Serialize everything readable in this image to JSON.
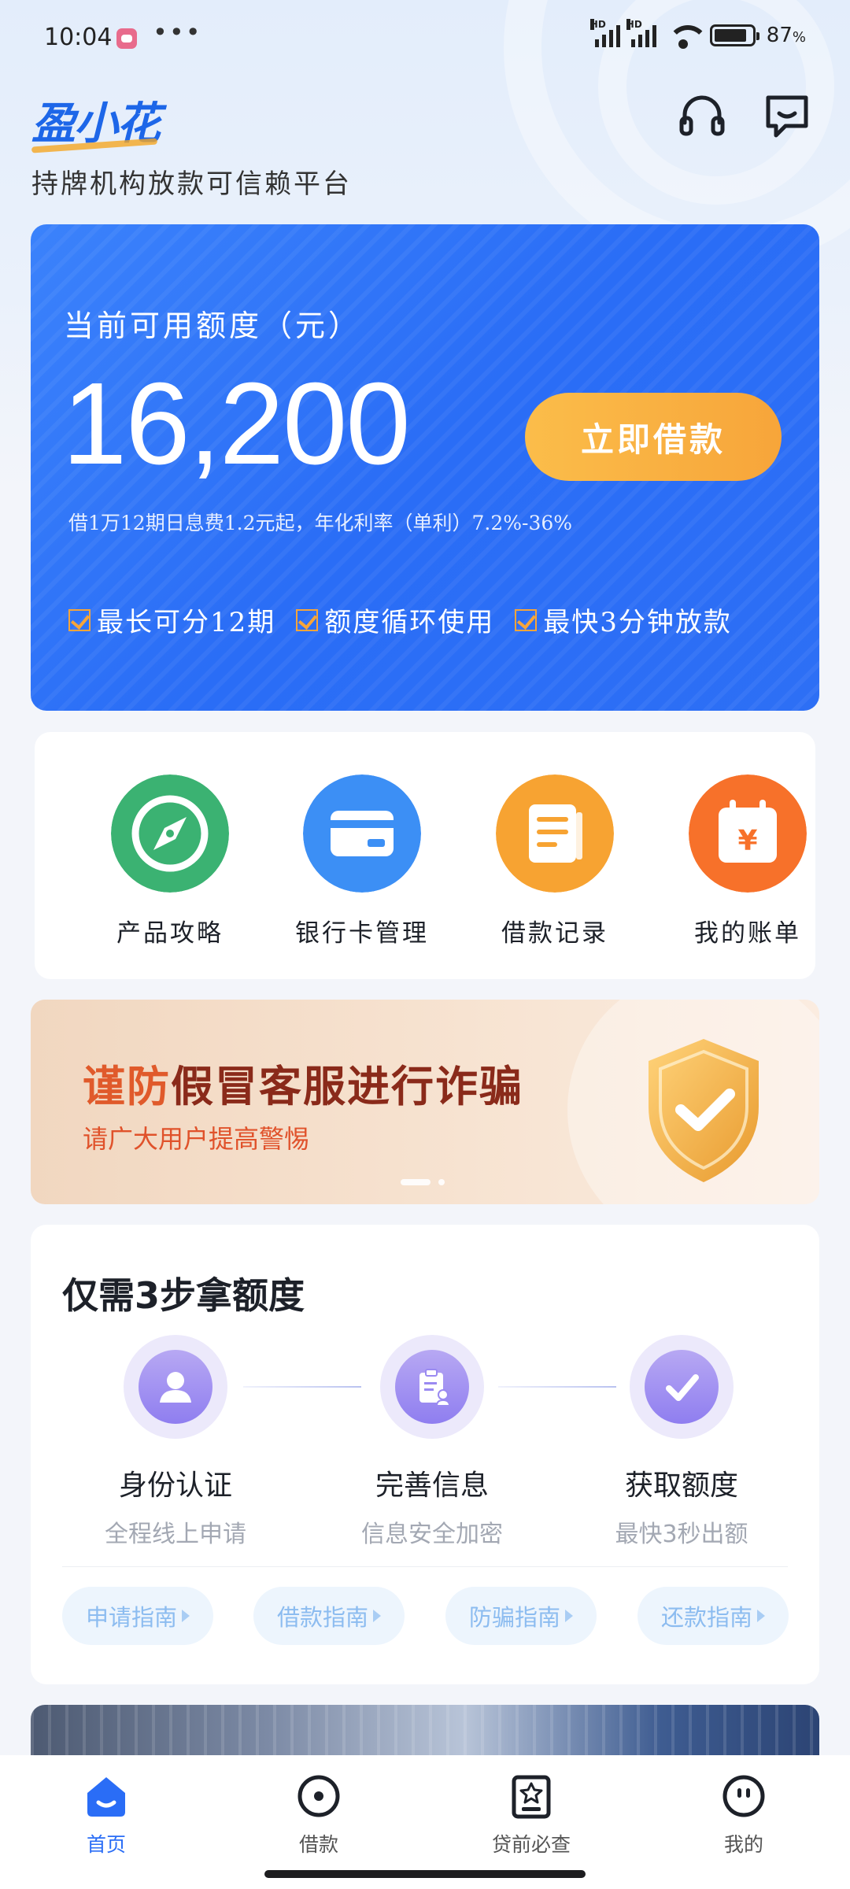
{
  "status_bar": {
    "time": "10:04",
    "battery": "87",
    "battery_unit": "%",
    "battery_level": 0.87,
    "signal_tag": "HD"
  },
  "header": {
    "logo_text": "盈小花",
    "tagline": "持牌机构放款可信赖平台",
    "icons": [
      "headset-icon",
      "message-icon"
    ]
  },
  "credit": {
    "label": "当前可用额度（元）",
    "amount": "16,200",
    "button": "立即借款",
    "rate_note": "借1万12期日息费1.2元起，年化利率（单利）7.2%-36%",
    "features": [
      "最长可分12期",
      "额度循环使用",
      "最快3分钟放款"
    ]
  },
  "quick_menu": [
    {
      "label": "产品攻略",
      "icon": "compass-icon",
      "color": "#3bb272"
    },
    {
      "label": "银行卡管理",
      "icon": "bank-card-icon",
      "color": "#3c8ff5"
    },
    {
      "label": "借款记录",
      "icon": "document-icon",
      "color": "#f7a332"
    },
    {
      "label": "我的账单",
      "icon": "bill-icon",
      "color": "#f7712a"
    }
  ],
  "banner": {
    "title_highlight": "谨防",
    "title_rest": "假冒客服进行诈骗",
    "subtitle": "请广大用户提高警惕"
  },
  "steps": {
    "title": "仅需3步拿额度",
    "items": [
      {
        "name": "身份认证",
        "desc": "全程线上申请",
        "icon": "user-icon"
      },
      {
        "name": "完善信息",
        "desc": "信息安全加密",
        "icon": "clipboard-icon"
      },
      {
        "name": "获取额度",
        "desc": "最快3秒出额",
        "icon": "check-icon"
      }
    ],
    "guides": [
      "申请指南",
      "借款指南",
      "防骗指南",
      "还款指南"
    ]
  },
  "tabs": [
    {
      "label": "首页",
      "icon": "home-icon",
      "active": true
    },
    {
      "label": "借款",
      "icon": "loan-icon",
      "active": false
    },
    {
      "label": "贷前必查",
      "icon": "check-report-icon",
      "active": false
    },
    {
      "label": "我的",
      "icon": "profile-icon",
      "active": false
    }
  ],
  "colors": {
    "primary": "#2a6df6",
    "accent": "#f7a53a"
  }
}
